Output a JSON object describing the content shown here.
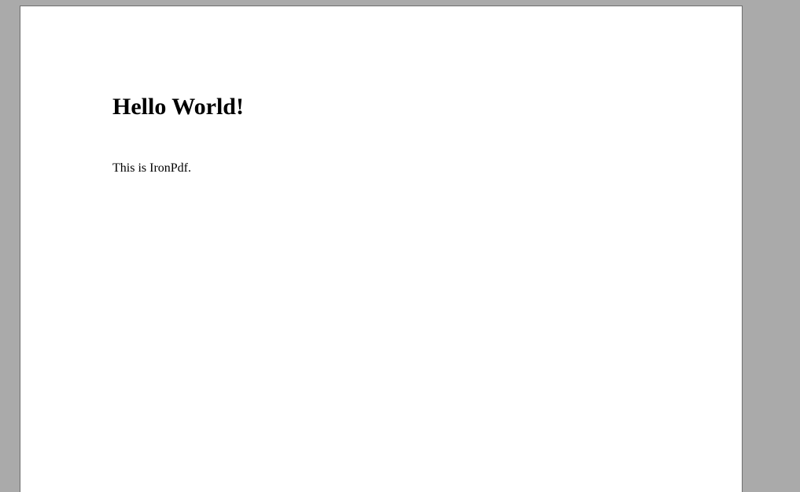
{
  "document": {
    "heading": "Hello World!",
    "paragraph": "This is IronPdf."
  }
}
